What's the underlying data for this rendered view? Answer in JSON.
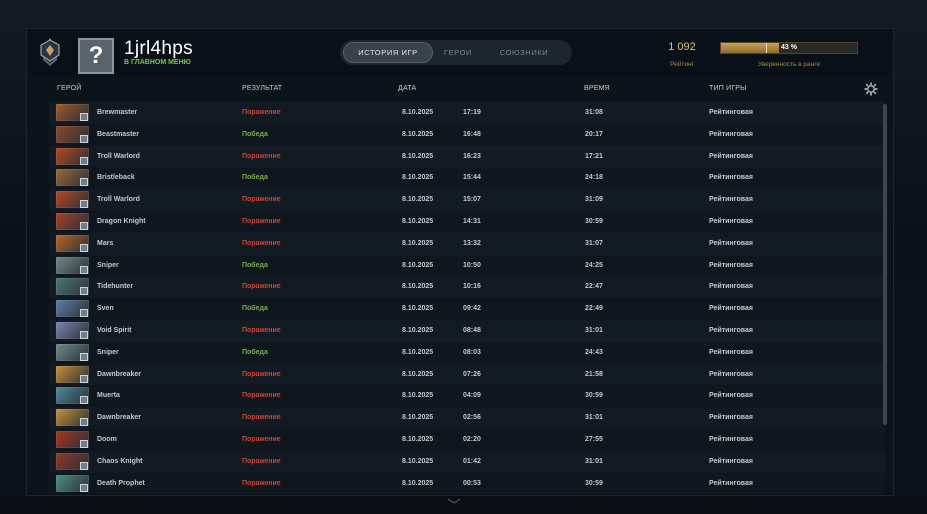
{
  "header": {
    "username": "1jrl4hps",
    "status": "В ГЛАВНОМ МЕНЮ",
    "avatar_glyph": "?",
    "rank_icon": "rank-medal-icon"
  },
  "tabs": [
    {
      "label": "ИСТОРИЯ ИГР",
      "active": true
    },
    {
      "label": "ГЕРОИ",
      "active": false
    },
    {
      "label": "СОЮЗНИКИ",
      "active": false
    }
  ],
  "rating": {
    "value": "1 092",
    "label": "Рейтинг"
  },
  "confidence": {
    "text": "43 %",
    "percent": 43,
    "label": "Уверенность в ранге"
  },
  "columns": {
    "hero": "ГЕРОЙ",
    "result": "РЕЗУЛЬТАТ",
    "date": "ДАТА",
    "duration": "ВРЕМЯ",
    "type": "ТИП ИГРЫ"
  },
  "settings_icon": "gear-icon",
  "colors": {
    "win": "#74b249",
    "loss": "#cf4431",
    "rating": "#e2c66b",
    "status": "#7cc25a"
  },
  "matches": [
    {
      "hero": "Brewmaster",
      "result": "Поражение",
      "outcome": "loss",
      "date": "8.10.2025",
      "time": "17:19",
      "duration": "31:08",
      "type": "Рейтинговая",
      "portrait": "#a35a2c"
    },
    {
      "hero": "Beastmaster",
      "result": "Победа",
      "outcome": "win",
      "date": "8.10.2025",
      "time": "16:48",
      "duration": "20:17",
      "type": "Рейтинговая",
      "portrait": "#8a4b2a"
    },
    {
      "hero": "Troll Warlord",
      "result": "Поражение",
      "outcome": "loss",
      "date": "8.10.2025",
      "time": "16:23",
      "duration": "17:21",
      "type": "Рейтинговая",
      "portrait": "#b34a22"
    },
    {
      "hero": "Bristleback",
      "result": "Победа",
      "outcome": "win",
      "date": "8.10.2025",
      "time": "15:44",
      "duration": "24:18",
      "type": "Рейтинговая",
      "portrait": "#9a6a3a"
    },
    {
      "hero": "Troll Warlord",
      "result": "Поражение",
      "outcome": "loss",
      "date": "8.10.2025",
      "time": "15:07",
      "duration": "31:09",
      "type": "Рейтинговая",
      "portrait": "#b34a22"
    },
    {
      "hero": "Dragon Knight",
      "result": "Поражение",
      "outcome": "loss",
      "date": "8.10.2025",
      "time": "14:31",
      "duration": "30:59",
      "type": "Рейтинговая",
      "portrait": "#a2452c"
    },
    {
      "hero": "Mars",
      "result": "Поражение",
      "outcome": "loss",
      "date": "8.10.2025",
      "time": "13:32",
      "duration": "31:07",
      "type": "Рейтинговая",
      "portrait": "#b8652a"
    },
    {
      "hero": "Sniper",
      "result": "Победа",
      "outcome": "win",
      "date": "8.10.2025",
      "time": "10:50",
      "duration": "24:25",
      "type": "Рейтинговая",
      "portrait": "#6e8c8a"
    },
    {
      "hero": "Tidehunter",
      "result": "Поражение",
      "outcome": "loss",
      "date": "8.10.2025",
      "time": "10:16",
      "duration": "22:47",
      "type": "Рейтинговая",
      "portrait": "#4d7a72"
    },
    {
      "hero": "Sven",
      "result": "Победа",
      "outcome": "win",
      "date": "8.10.2025",
      "time": "09:42",
      "duration": "22:49",
      "type": "Рейтинговая",
      "portrait": "#5d7fa6"
    },
    {
      "hero": "Void Spirit",
      "result": "Поражение",
      "outcome": "loss",
      "date": "8.10.2025",
      "time": "08:48",
      "duration": "31:01",
      "type": "Рейтинговая",
      "portrait": "#7a86b2"
    },
    {
      "hero": "Sniper",
      "result": "Победа",
      "outcome": "win",
      "date": "8.10.2025",
      "time": "08:03",
      "duration": "24:43",
      "type": "Рейтинговая",
      "portrait": "#6e8c8a"
    },
    {
      "hero": "Dawnbreaker",
      "result": "Поражение",
      "outcome": "loss",
      "date": "8.10.2025",
      "time": "07:26",
      "duration": "21:58",
      "type": "Рейтинговая",
      "portrait": "#c7923a"
    },
    {
      "hero": "Muerta",
      "result": "Поражение",
      "outcome": "loss",
      "date": "8.10.2025",
      "time": "04:09",
      "duration": "30:59",
      "type": "Рейтинговая",
      "portrait": "#4f8a9c"
    },
    {
      "hero": "Dawnbreaker",
      "result": "Поражение",
      "outcome": "loss",
      "date": "8.10.2025",
      "time": "02:56",
      "duration": "31:01",
      "type": "Рейтинговая",
      "portrait": "#c7923a"
    },
    {
      "hero": "Doom",
      "result": "Поражение",
      "outcome": "loss",
      "date": "8.10.2025",
      "time": "02:20",
      "duration": "27:55",
      "type": "Рейтинговая",
      "portrait": "#a8371e"
    },
    {
      "hero": "Chaos Knight",
      "result": "Поражение",
      "outcome": "loss",
      "date": "8.10.2025",
      "time": "01:42",
      "duration": "31:01",
      "type": "Рейтинговая",
      "portrait": "#8f3a2a"
    },
    {
      "hero": "Death Prophet",
      "result": "Поражение",
      "outcome": "loss",
      "date": "8.10.2025",
      "time": "00:53",
      "duration": "30:59",
      "type": "Рейтинговая",
      "portrait": "#4e8f7e"
    }
  ]
}
